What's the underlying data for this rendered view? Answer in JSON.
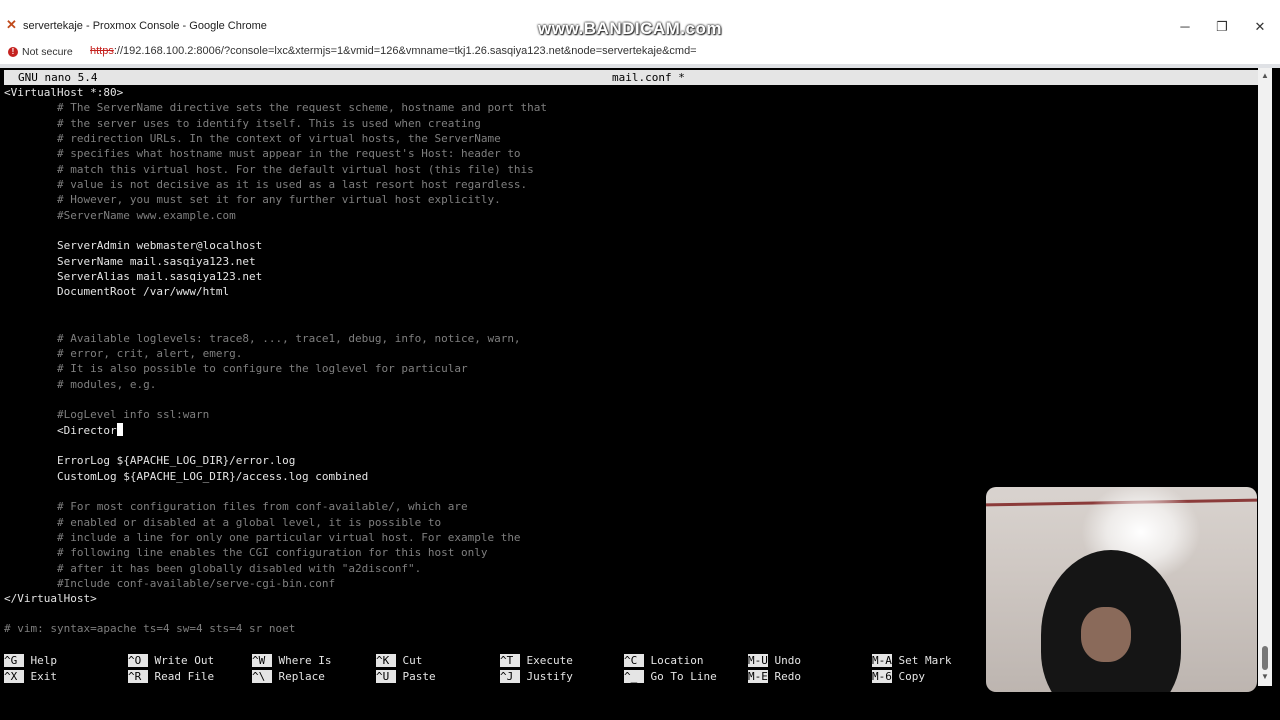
{
  "browser": {
    "tab_title": "servertekaje - Proxmox Console - Google Chrome",
    "watermark": "www.BANDICAM.com",
    "security_label": "Not secure",
    "url_scheme": "https",
    "url_rest": "://192.168.100.2:8006/?console=lxc&xtermjs=1&vmid=126&vmname=tkj1.26.sasqiya123.net&node=servertekaje&cmd="
  },
  "nano": {
    "version": "GNU nano 5.4",
    "filename": "mail.conf *",
    "lines": [
      {
        "text": "<VirtualHost *:80>",
        "comment": false
      },
      {
        "text": "        # The ServerName directive sets the request scheme, hostname and port that",
        "comment": true
      },
      {
        "text": "        # the server uses to identify itself. This is used when creating",
        "comment": true
      },
      {
        "text": "        # redirection URLs. In the context of virtual hosts, the ServerName",
        "comment": true
      },
      {
        "text": "        # specifies what hostname must appear in the request's Host: header to",
        "comment": true
      },
      {
        "text": "        # match this virtual host. For the default virtual host (this file) this",
        "comment": true
      },
      {
        "text": "        # value is not decisive as it is used as a last resort host regardless.",
        "comment": true
      },
      {
        "text": "        # However, you must set it for any further virtual host explicitly.",
        "comment": true
      },
      {
        "text": "        #ServerName www.example.com",
        "comment": true
      },
      {
        "text": "",
        "comment": false
      },
      {
        "text": "        ServerAdmin webmaster@localhost",
        "comment": false
      },
      {
        "text": "        ServerName mail.sasqiya123.net",
        "comment": false
      },
      {
        "text": "        ServerAlias mail.sasqiya123.net",
        "comment": false
      },
      {
        "text": "        DocumentRoot /var/www/html",
        "comment": false
      },
      {
        "text": "",
        "comment": false
      },
      {
        "text": "",
        "comment": false
      },
      {
        "text": "        # Available loglevels: trace8, ..., trace1, debug, info, notice, warn,",
        "comment": true
      },
      {
        "text": "        # error, crit, alert, emerg.",
        "comment": true
      },
      {
        "text": "        # It is also possible to configure the loglevel for particular",
        "comment": true
      },
      {
        "text": "        # modules, e.g.",
        "comment": true
      },
      {
        "text": "",
        "comment": false
      },
      {
        "text": "        #LogLevel info ssl:warn",
        "comment": true
      },
      {
        "text": "        <Director",
        "comment": false,
        "cursor": true
      },
      {
        "text": "",
        "comment": false
      },
      {
        "text": "        ErrorLog ${APACHE_LOG_DIR}/error.log",
        "comment": false
      },
      {
        "text": "        CustomLog ${APACHE_LOG_DIR}/access.log combined",
        "comment": false
      },
      {
        "text": "",
        "comment": false
      },
      {
        "text": "        # For most configuration files from conf-available/, which are",
        "comment": true
      },
      {
        "text": "        # enabled or disabled at a global level, it is possible to",
        "comment": true
      },
      {
        "text": "        # include a line for only one particular virtual host. For example the",
        "comment": true
      },
      {
        "text": "        # following line enables the CGI configuration for this host only",
        "comment": true
      },
      {
        "text": "        # after it has been globally disabled with \"a2disconf\".",
        "comment": true
      },
      {
        "text": "        #Include conf-available/serve-cgi-bin.conf",
        "comment": true
      },
      {
        "text": "</VirtualHost>",
        "comment": false
      }
    ],
    "modeline": "# vim: syntax=apache ts=4 sw=4 sts=4 sr noet",
    "shortcuts": [
      {
        "key": "^G",
        "label": "Help"
      },
      {
        "key": "^O",
        "label": "Write Out"
      },
      {
        "key": "^W",
        "label": "Where Is"
      },
      {
        "key": "^K",
        "label": "Cut"
      },
      {
        "key": "^T",
        "label": "Execute"
      },
      {
        "key": "^C",
        "label": "Location"
      },
      {
        "key": "M-U",
        "label": "Undo"
      },
      {
        "key": "M-A",
        "label": "Set Mark"
      },
      {
        "key": "^X",
        "label": "Exit"
      },
      {
        "key": "^R",
        "label": "Read File"
      },
      {
        "key": "^\\",
        "label": "Replace"
      },
      {
        "key": "^U",
        "label": "Paste"
      },
      {
        "key": "^J",
        "label": "Justify"
      },
      {
        "key": "^_",
        "label": "Go To Line"
      },
      {
        "key": "M-E",
        "label": "Redo"
      },
      {
        "key": "M-6",
        "label": "Copy"
      }
    ]
  }
}
